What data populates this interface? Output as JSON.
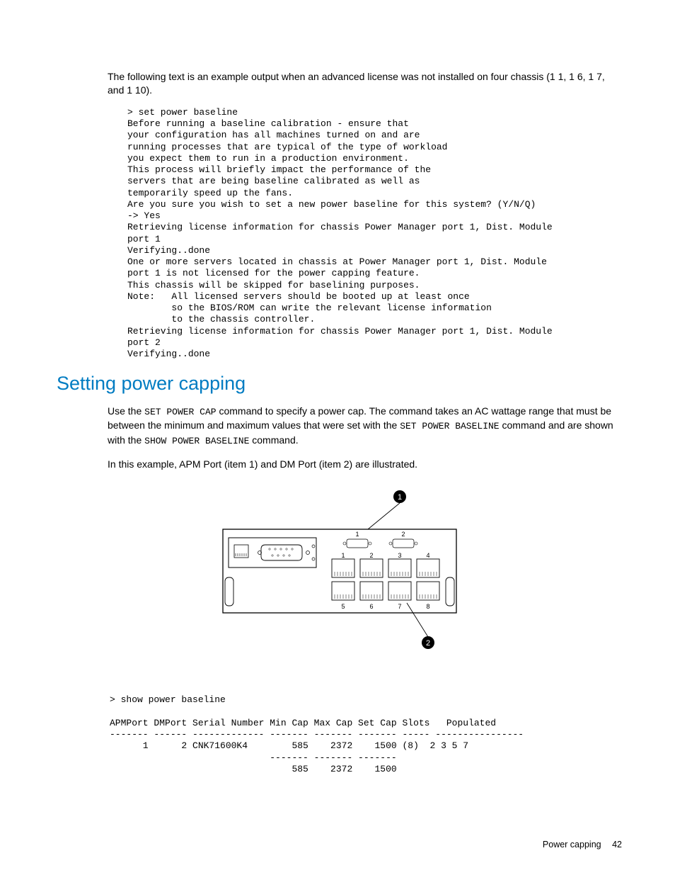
{
  "intro": "The following text is an example output when an advanced license was not installed on four chassis (1 1, 1 6, 1 7, and 1 10).",
  "code1": "> set power baseline\nBefore running a baseline calibration - ensure that\nyour configuration has all machines turned on and are\nrunning processes that are typical of the type of workload\nyou expect them to run in a production environment.\nThis process will briefly impact the performance of the\nservers that are being baseline calibrated as well as\ntemporarily speed up the fans.\nAre you sure you wish to set a new power baseline for this system? (Y/N/Q)\n-> Yes\nRetrieving license information for chassis Power Manager port 1, Dist. Module\nport 1\nVerifying..done\nOne or more servers located in chassis at Power Manager port 1, Dist. Module\nport 1 is not licensed for the power capping feature.\nThis chassis will be skipped for baselining purposes.\nNote:   All licensed servers should be booted up at least once\n        so the BIOS/ROM can write the relevant license information\n        to the chassis controller.\nRetrieving license information for chassis Power Manager port 1, Dist. Module\nport 2\nVerifying..done",
  "heading": "Setting power capping",
  "para1_a": "Use the ",
  "para1_cmd1": "SET POWER CAP",
  "para1_b": " command to specify a power cap. The command takes an AC wattage range that must be between the minimum and maximum values that were set with the ",
  "para1_cmd2": "SET POWER BASELINE",
  "para1_c": " command and are shown with the ",
  "para1_cmd3": "SHOW POWER BASELINE",
  "para1_d": " command.",
  "para2": "In this example, APM Port (item 1) and DM Port (item 2) are illustrated.",
  "diagram": {
    "callouts": {
      "top": "1",
      "bottom": "2"
    },
    "serial_labels_top": [
      "1",
      "2"
    ],
    "port_labels_top": [
      "1",
      "2",
      "3",
      "4"
    ],
    "port_labels_bottom": [
      "5",
      "6",
      "7",
      "8"
    ]
  },
  "code2": "> show power baseline\n\nAPMPort DMPort Serial Number Min Cap Max Cap Set Cap Slots   Populated\n------- ------ ------------- ------- ------- ------- ----- ----------------\n      1      2 CNK71600K4        585    2372    1500 (8)  2 3 5 7\n                             ------- ------- -------\n                                 585    2372    1500",
  "footer_label": "Power capping",
  "footer_page": "42"
}
